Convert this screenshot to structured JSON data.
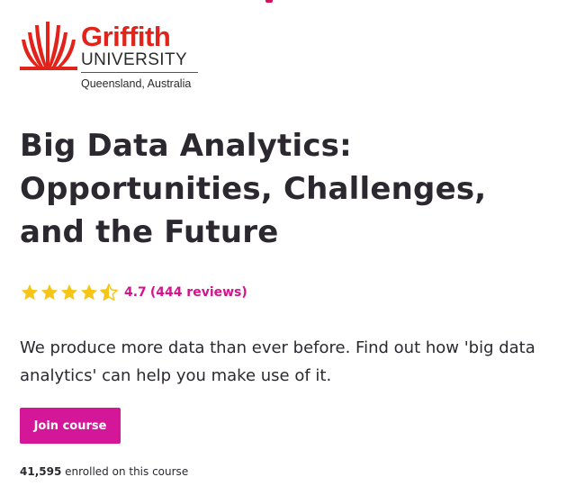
{
  "brand": {
    "name": "Griffith",
    "subtitle": "UNIVERSITY",
    "location": "Queensland, Australia",
    "primary_color": "#e2231a"
  },
  "course": {
    "title_lines": [
      "Big Data Analytics:",
      "Opportunities, Challenges,",
      "and the Future"
    ],
    "rating": {
      "value": "4.7",
      "reviews_text": "(444 reviews)",
      "stars_value": 4.5,
      "stars_max": 5,
      "star_color": "#f5c518",
      "text_color": "#d4148a"
    },
    "description": "We produce more data than ever before. Find out how 'big data analytics' can help you make use of it.",
    "join_label": "Join course",
    "join_color": "#d41799",
    "enrolled_count": "41,595",
    "enrolled_suffix": " enrolled on this course"
  },
  "icons": {
    "star": "star-icon",
    "logo": "griffith-logo-icon"
  }
}
